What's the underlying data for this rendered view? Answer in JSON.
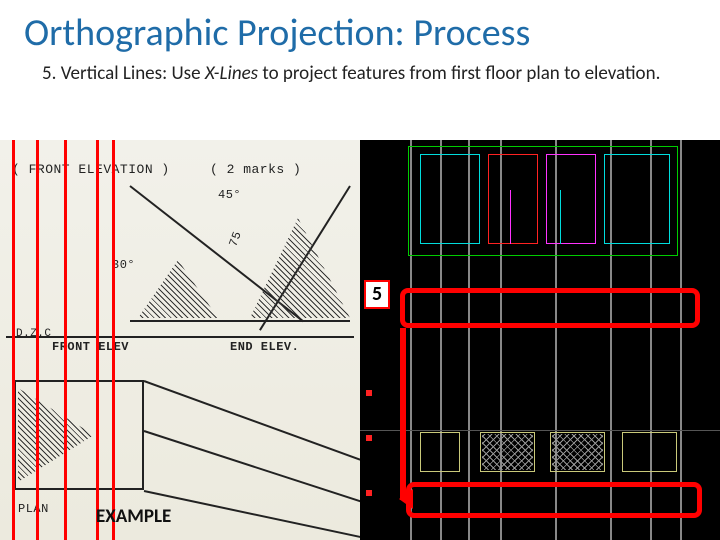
{
  "title": "Orthographic Projection: Process",
  "subtitle_prefix": "5. Vertical Lines: Use ",
  "subtitle_em": "X-Lines",
  "subtitle_rest": " to project features from first floor plan to elevation.",
  "left": {
    "example_label": "EXAMPLE",
    "labels": {
      "front_elev": "( FRONT ELEVATION )",
      "marks": "( 2 marks )",
      "front_elev2": "FRONT ELEV",
      "end_elev": "END ELEV.",
      "plan": "PLAN",
      "angle45": "45°",
      "angle30": "30°",
      "dim75": "75",
      "dzc": "D.Z.C"
    }
  },
  "right": {
    "step_number": "5"
  }
}
